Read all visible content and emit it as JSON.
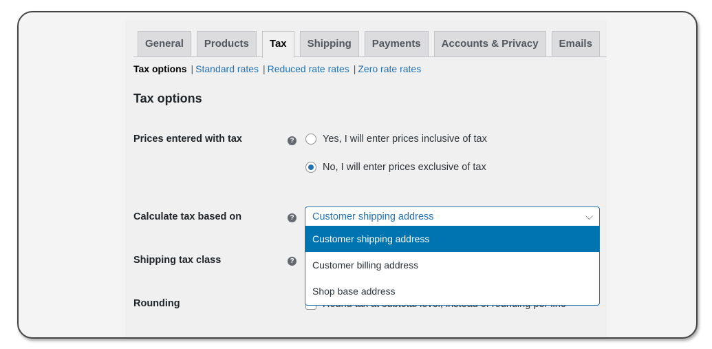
{
  "tabs": [
    {
      "label": "General",
      "active": false
    },
    {
      "label": "Products",
      "active": false
    },
    {
      "label": "Tax",
      "active": true
    },
    {
      "label": "Shipping",
      "active": false
    },
    {
      "label": "Payments",
      "active": false
    },
    {
      "label": "Accounts & Privacy",
      "active": false
    },
    {
      "label": "Emails",
      "active": false
    }
  ],
  "subnav": {
    "current": "Tax options",
    "links": [
      "Standard rates",
      "Reduced rate rates",
      "Zero rate rates"
    ],
    "separator": "|"
  },
  "section_title": "Tax options",
  "fields": {
    "prices_entered": {
      "label": "Prices entered with tax",
      "help_icon": "question-circle-icon",
      "options": [
        {
          "label": "Yes, I will enter prices inclusive of tax",
          "checked": false
        },
        {
          "label": "No, I will enter prices exclusive of tax",
          "checked": true
        }
      ]
    },
    "calculate_based_on": {
      "label": "Calculate tax based on",
      "help_icon": "question-circle-icon",
      "selected": "Customer shipping address",
      "chevron": "⌵",
      "options": [
        "Customer shipping address",
        "Customer billing address",
        "Shop base address"
      ],
      "highlighted_index": 0
    },
    "shipping_tax_class": {
      "label": "Shipping tax class",
      "help_icon": "question-circle-icon"
    },
    "rounding": {
      "label": "Rounding",
      "checkbox_label": "Round tax at subtotal level, instead of rounding per line",
      "checked": false
    }
  },
  "help_glyph": "?"
}
